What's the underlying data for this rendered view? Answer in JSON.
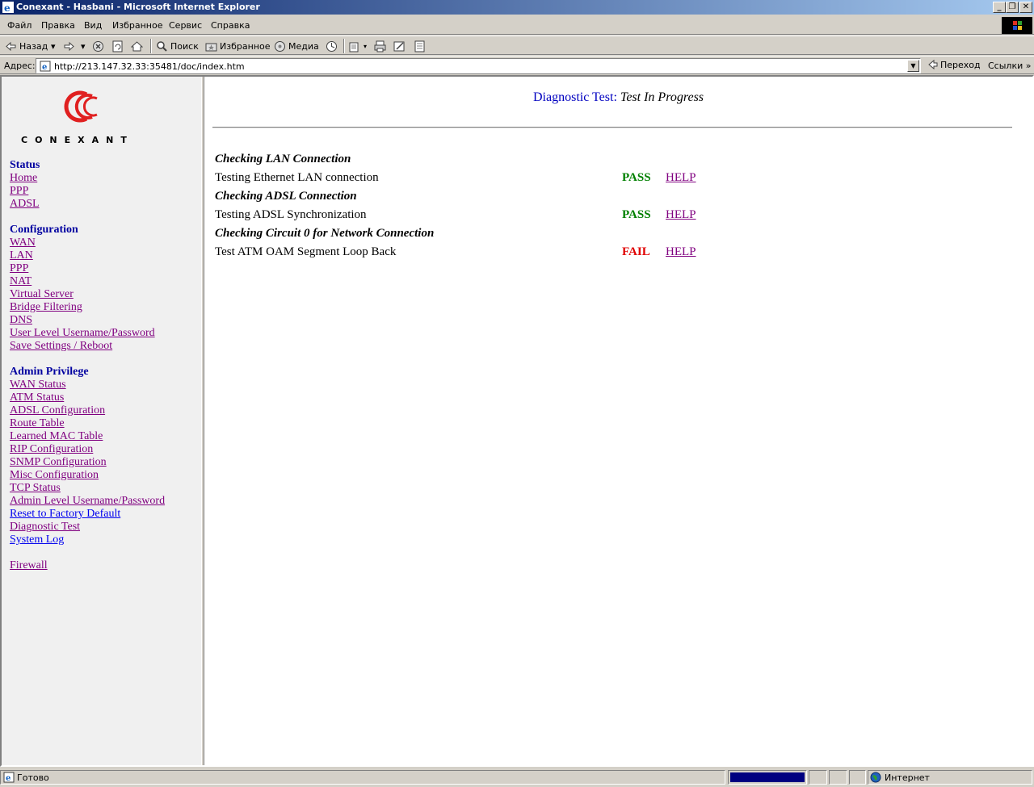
{
  "window": {
    "title": "Conexant - Hasbani - Microsoft Internet Explorer"
  },
  "menu": [
    "Файл",
    "Правка",
    "Вид",
    "Избранное",
    "Сервис",
    "Справка"
  ],
  "toolbar": {
    "back": "Назад",
    "search": "Поиск",
    "favorites": "Избранное",
    "media": "Медиа"
  },
  "address": {
    "label": "Адрес:",
    "url": "http://213.147.32.33:35481/doc/index.htm",
    "go": "Переход",
    "links": "Ссылки"
  },
  "sidebar": {
    "logo_text": "CONEXANT",
    "status_heading": "Status",
    "status_items": [
      "Home",
      "PPP",
      "ADSL"
    ],
    "config_heading": "Configuration",
    "config_items": [
      "WAN",
      "LAN",
      "PPP",
      "NAT",
      "Virtual Server",
      "Bridge Filtering",
      "DNS",
      "User Level Username/Password",
      "Save Settings / Reboot"
    ],
    "admin_heading": "Admin Privilege",
    "admin_items": [
      "WAN Status",
      "ATM Status",
      "ADSL Configuration",
      "Route Table",
      "Learned MAC Table",
      "RIP Configuration",
      "SNMP Configuration",
      "Misc Configuration",
      "TCP Status",
      "Admin Level Username/Password",
      "Reset to Factory Default",
      "Diagnostic Test",
      "System Log"
    ],
    "firewall": "Firewall"
  },
  "main": {
    "title_prefix": "Diagnostic Test:",
    "title_status": "Test In Progress",
    "checks": [
      {
        "heading": "Checking LAN Connection",
        "test": "Testing Ethernet LAN connection",
        "result": "PASS",
        "help": "HELP"
      },
      {
        "heading": "Checking ADSL Connection",
        "test": "Testing ADSL Synchronization",
        "result": "PASS",
        "help": "HELP"
      },
      {
        "heading": "Checking Circuit 0 for Network Connection",
        "test": "Test ATM OAM Segment Loop Back",
        "result": "FAIL",
        "help": "HELP"
      }
    ]
  },
  "statusbar": {
    "text": "Готово",
    "zone": "Интернет"
  },
  "colors": {
    "pass": "#008000",
    "fail": "#e00000",
    "heading": "#0000a0",
    "visited_link": "#800080"
  }
}
